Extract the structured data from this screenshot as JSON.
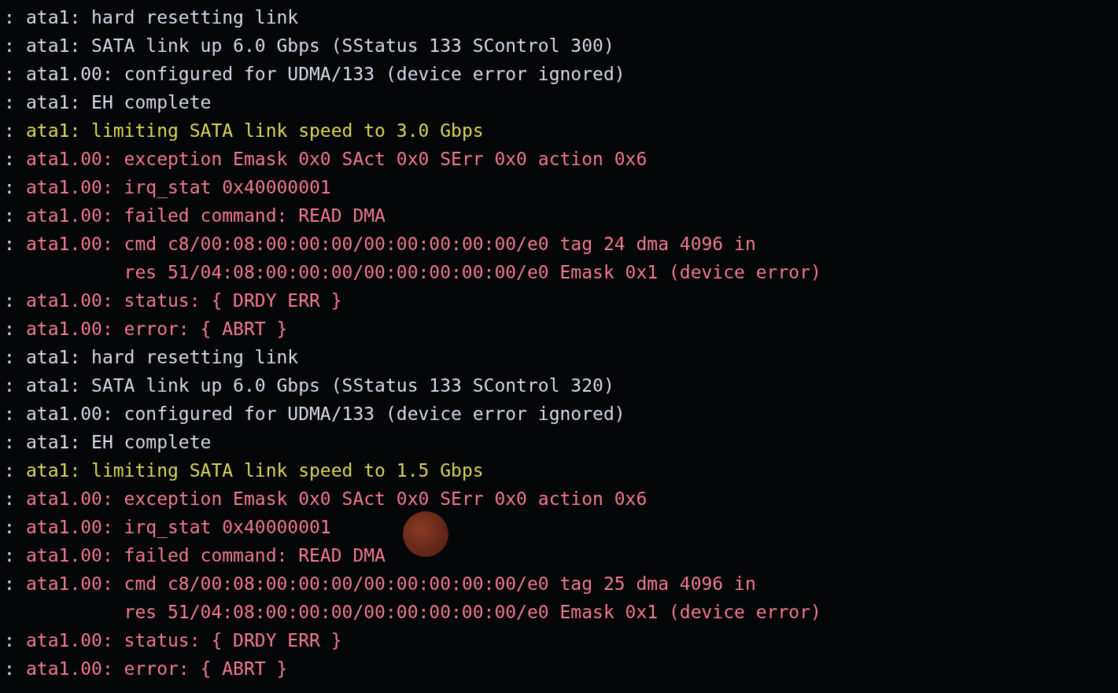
{
  "terminal": {
    "lines": [
      {
        "prefix": ":",
        "text": "ata1: hard resetting link",
        "kind": "info"
      },
      {
        "prefix": ":",
        "text": "ata1: SATA link up 6.0 Gbps (SStatus 133 SControl 300)",
        "kind": "info"
      },
      {
        "prefix": ":",
        "text": "ata1.00: configured for UDMA/133 (device error ignored)",
        "kind": "info"
      },
      {
        "prefix": ":",
        "text": "ata1: EH complete",
        "kind": "info"
      },
      {
        "prefix": ":",
        "text": "ata1: limiting SATA link speed to 3.0 Gbps",
        "kind": "warning"
      },
      {
        "prefix": ":",
        "text": "ata1.00: exception Emask 0x0 SAct 0x0 SErr 0x0 action 0x6",
        "kind": "error"
      },
      {
        "prefix": ":",
        "text": "ata1.00: irq_stat 0x40000001",
        "kind": "error"
      },
      {
        "prefix": ":",
        "text": "ata1.00: failed command: READ DMA",
        "kind": "error"
      },
      {
        "prefix": ":",
        "text": "ata1.00: cmd c8/00:08:00:00:00/00:00:00:00:00/e0 tag 24 dma 4096 in",
        "kind": "error"
      },
      {
        "text": "res 51/04:08:00:00:00/00:00:00:00:00/e0 Emask 0x1 (device error)",
        "kind": "error-continuation"
      },
      {
        "prefix": ":",
        "text": "ata1.00: status: { DRDY ERR }",
        "kind": "error"
      },
      {
        "prefix": ":",
        "text": "ata1.00: error: { ABRT }",
        "kind": "error"
      },
      {
        "prefix": ":",
        "text": "ata1: hard resetting link",
        "kind": "info"
      },
      {
        "prefix": ":",
        "text": "ata1: SATA link up 6.0 Gbps (SStatus 133 SControl 320)",
        "kind": "info"
      },
      {
        "prefix": ":",
        "text": "ata1.00: configured for UDMA/133 (device error ignored)",
        "kind": "info"
      },
      {
        "prefix": ":",
        "text": "ata1: EH complete",
        "kind": "info"
      },
      {
        "prefix": ":",
        "text": "ata1: limiting SATA link speed to 1.5 Gbps",
        "kind": "warning"
      },
      {
        "prefix": ":",
        "text": "ata1.00: exception Emask 0x0 SAct 0x0 SErr 0x0 action 0x6",
        "kind": "error"
      },
      {
        "prefix": ":",
        "text": "ata1.00: irq_stat 0x40000001",
        "kind": "error"
      },
      {
        "prefix": ":",
        "text": "ata1.00: failed command: READ DMA",
        "kind": "error"
      },
      {
        "prefix": ":",
        "text": "ata1.00: cmd c8/00:08:00:00:00/00:00:00:00:00/e0 tag 25 dma 4096 in",
        "kind": "error"
      },
      {
        "text": "res 51/04:08:00:00:00/00:00:00:00:00/e0 Emask 0x1 (device error)",
        "kind": "error-continuation"
      },
      {
        "prefix": ":",
        "text": "ata1.00: status: { DRDY ERR }",
        "kind": "error"
      },
      {
        "prefix": ":",
        "text": "ata1.00: error: { ABRT }",
        "kind": "error"
      }
    ]
  }
}
